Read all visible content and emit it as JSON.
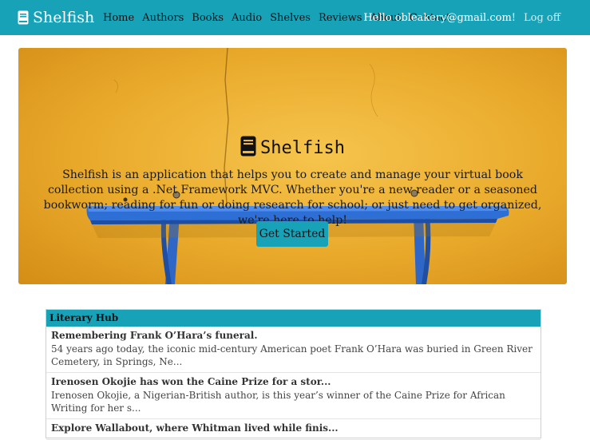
{
  "navbar": {
    "brand": "Shelfish",
    "links": [
      "Home",
      "Authors",
      "Books",
      "Audio",
      "Shelves",
      "Reviews",
      "About",
      "Contact"
    ],
    "greeting": "Hello obleakery@gmail.com!",
    "logoff": "Log off",
    "accent": "#17a2b8"
  },
  "hero": {
    "title": "Shelfish",
    "description": "Shelfish is an application that helps you to create and manage your virtual book collection using a .Net Framework MVC. Whether you're a new reader or a seasoned bookworm; reading for fun or doing research for school; or just need to get organized, we're here to help!",
    "cta": "Get Started",
    "icon": "book-icon"
  },
  "feed": {
    "source": "Literary Hub",
    "items": [
      {
        "title": "Remembering Frank O’Hara’s funeral.",
        "snippet": "54 years ago today, the iconic mid-century American poet Frank O’Hara was buried in Green River Cemetery, in Springs, Ne..."
      },
      {
        "title": "Irenosen Okojie has won the Caine Prize for a stor...",
        "snippet": "Irenosen Okojie, a Nigerian-British author, is this year’s winner of the Caine Prize for African Writing for her s..."
      },
      {
        "title": "Explore Wallabout, where Whitman lived while finis...",
        "snippet": ""
      }
    ]
  }
}
